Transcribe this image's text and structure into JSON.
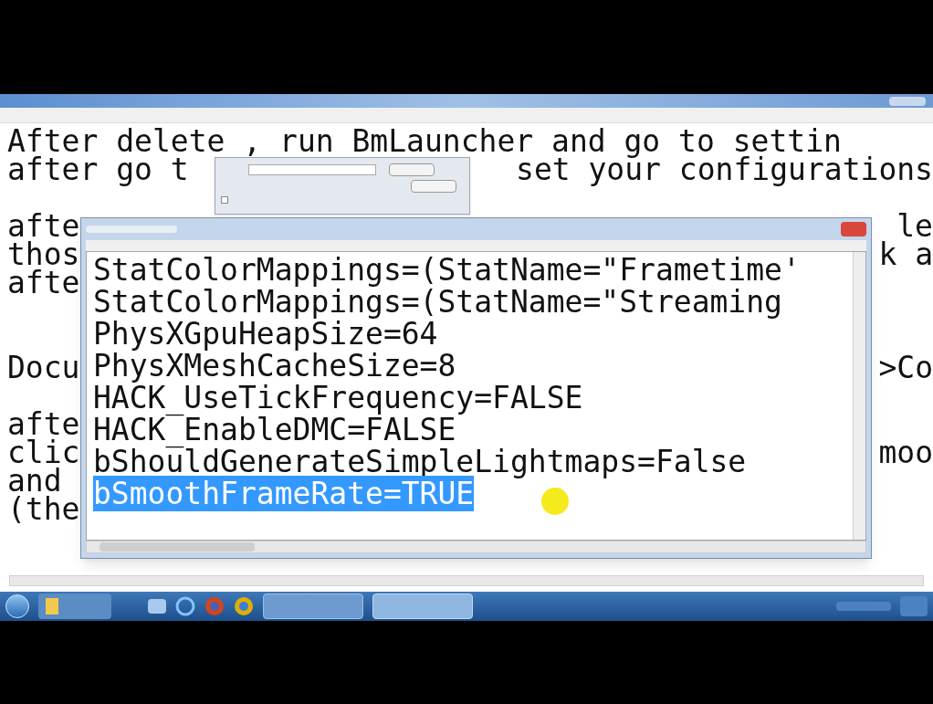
{
  "back_notepad": {
    "lines": [
      {
        "kind": "text",
        "left": "After delete , run BmLauncher and go to settin"
      },
      {
        "kind": "text",
        "left": "after go t",
        "right": "set your configurations"
      },
      {
        "kind": "blank"
      },
      {
        "kind": "text",
        "left": "afte",
        "right": "le"
      },
      {
        "kind": "text",
        "left": "thos",
        "right": "k a"
      },
      {
        "kind": "text",
        "left": "afte"
      },
      {
        "kind": "blank"
      },
      {
        "kind": "blank"
      },
      {
        "kind": "text",
        "left": "Docu",
        "right": ">Co"
      },
      {
        "kind": "blank"
      },
      {
        "kind": "text",
        "left": "afte"
      },
      {
        "kind": "text",
        "left": "clic",
        "right": "moo"
      },
      {
        "kind": "text",
        "left": "and"
      },
      {
        "kind": "text",
        "left": "(the"
      }
    ]
  },
  "find_dialog": {
    "match_case": {
      "checked": false
    }
  },
  "front_notepad": {
    "lines": [
      {
        "text": "StatColorMappings=(StatName=\"Frametime'",
        "selected": false
      },
      {
        "text": "StatColorMappings=(StatName=\"Streaming",
        "selected": false
      },
      {
        "text": "PhysXGpuHeapSize=64",
        "selected": false
      },
      {
        "text": "PhysXMeshCacheSize=8",
        "selected": false
      },
      {
        "text": "HACK_UseTickFrequency=FALSE",
        "selected": false
      },
      {
        "text": "HACK_EnableDMC=FALSE",
        "selected": false
      },
      {
        "text": "bShouldGenerateSimpleLightmaps=False",
        "selected": false
      },
      {
        "text": "bSmoothFrameRate=TRUE",
        "selected": true
      }
    ]
  }
}
